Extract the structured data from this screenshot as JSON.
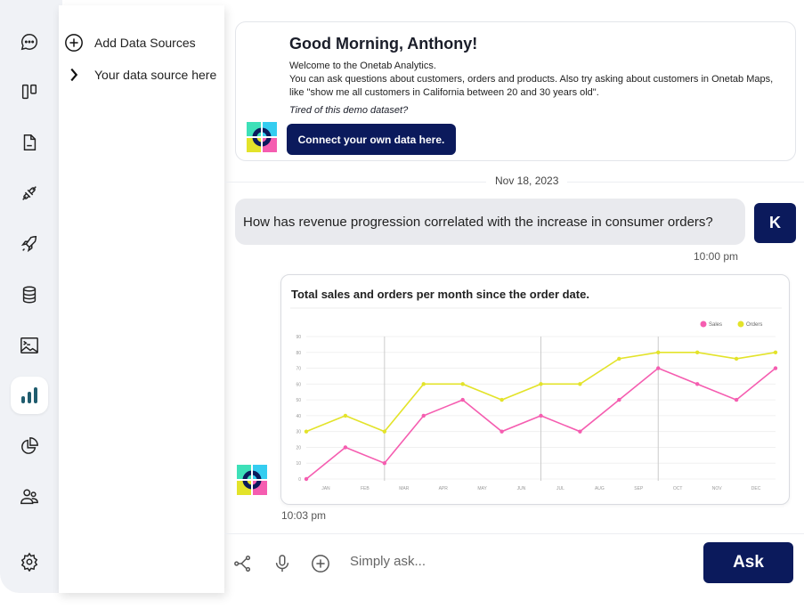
{
  "sidebar": {
    "icons": [
      "chat-icon",
      "board-icon",
      "document-icon",
      "plug-icon",
      "rocket-icon",
      "database-icon",
      "terminal-image-icon",
      "bar-chart-icon",
      "pie-chart-icon",
      "users-icon",
      "settings-icon"
    ],
    "active": "bar-chart-icon"
  },
  "panel": {
    "add_label": "Add Data Sources",
    "source_label": "Your data source here"
  },
  "welcome": {
    "title": "Good Morning, Anthony!",
    "line1": "Welcome to the Onetab Analytics.",
    "line2": "You can ask questions about customers, orders and products. Also try asking about customers in Onetab Maps, like \"show me all customers in California between 20 and 30 years old\".",
    "tired": "Tired of this demo dataset?",
    "connect_label": "Connect your own data here."
  },
  "chat": {
    "date": "Nov 18, 2023",
    "user_message": "How has revenue progression correlated with the increase in consumer orders?",
    "user_avatar": "K",
    "user_time": "10:00 pm",
    "bot_time": "10:03 pm"
  },
  "chart_data": {
    "type": "line",
    "title": "Total sales and orders per month since the order date.",
    "categories": [
      "JAN",
      "FEB",
      "MAR",
      "APR",
      "MAY",
      "JUN",
      "JUL",
      "AUG",
      "SEP",
      "OCT",
      "NOV",
      "DEC"
    ],
    "series": [
      {
        "name": "Sales",
        "color": "#f55db0",
        "values": [
          0,
          20,
          10,
          40,
          50,
          30,
          40,
          30,
          50,
          70,
          60,
          50,
          70
        ]
      },
      {
        "name": "Orders",
        "color": "#e3e32a",
        "values": [
          30,
          40,
          30,
          60,
          60,
          50,
          60,
          60,
          76,
          80,
          80,
          76,
          80
        ]
      }
    ],
    "ylim": [
      0,
      90
    ],
    "yticks": [
      "0",
      "10",
      "20",
      "30",
      "40",
      "50",
      "60",
      "70",
      "80",
      "90"
    ],
    "grid": true,
    "legend": "top-right"
  },
  "input": {
    "placeholder": "Simply ask...",
    "ask_label": "Ask"
  },
  "colors": {
    "navy": "#0b1a5c",
    "rail": "#f0f2f6",
    "active_icon": "#1f5c6e"
  }
}
